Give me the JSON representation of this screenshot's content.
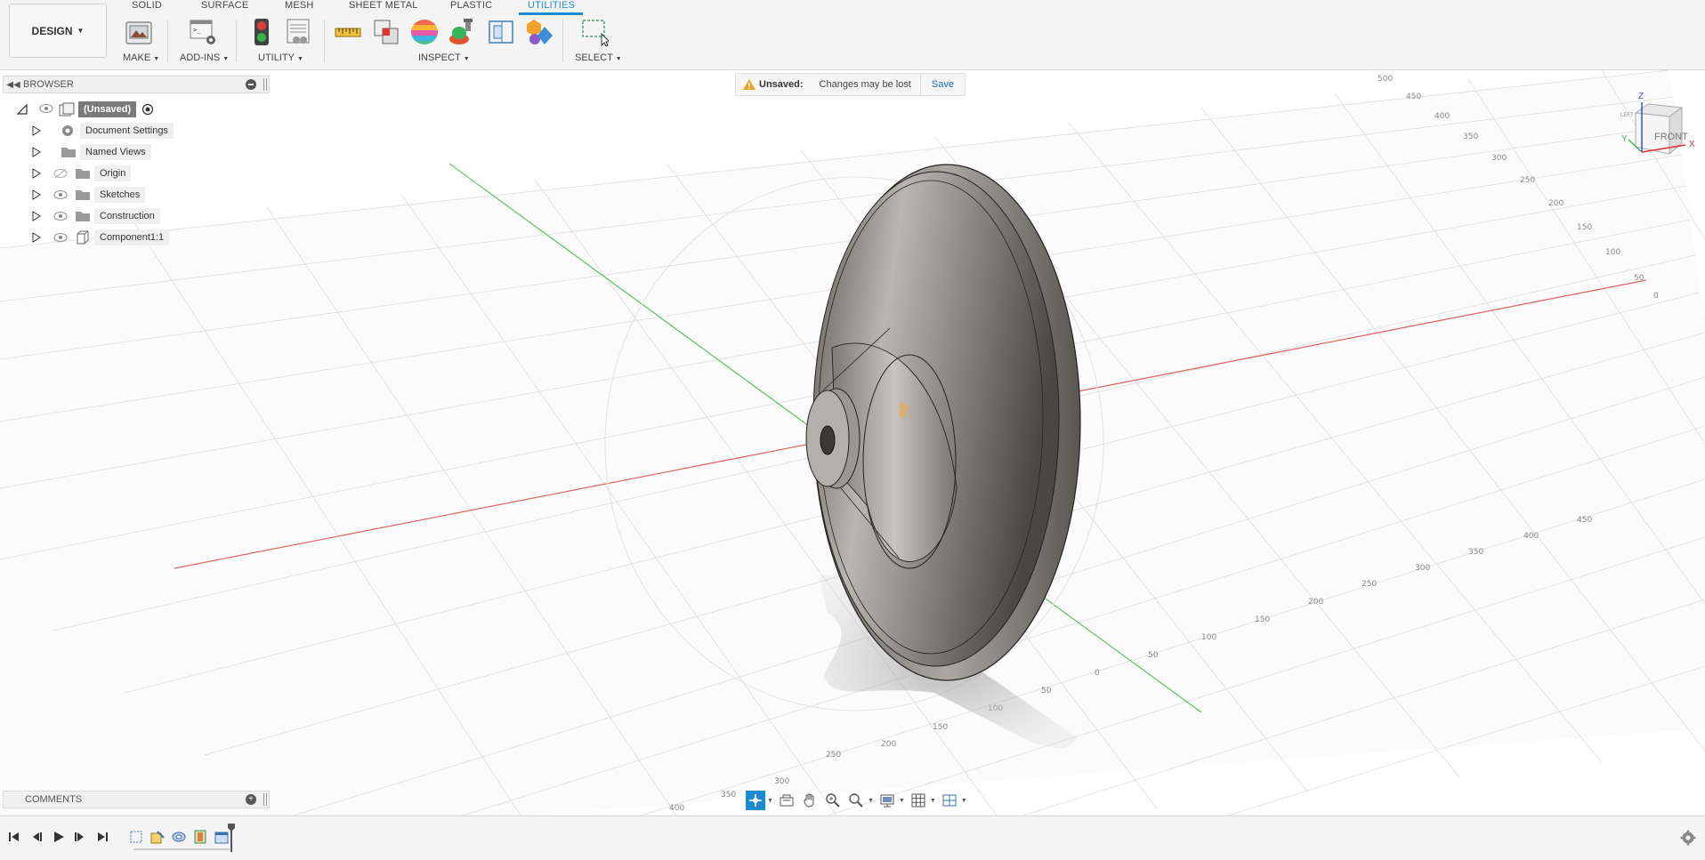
{
  "toolbar": {
    "workspace_label": "DESIGN",
    "tabs": [
      {
        "label": "SOLID",
        "active": false
      },
      {
        "label": "SURFACE",
        "active": false
      },
      {
        "label": "MESH",
        "active": false
      },
      {
        "label": "SHEET METAL",
        "active": false
      },
      {
        "label": "PLASTIC",
        "active": false
      },
      {
        "label": "UTILITIES",
        "active": true
      }
    ],
    "groups": {
      "make": "MAKE",
      "addins": "ADD-INS",
      "utility": "UTILITY",
      "inspect": "INSPECT",
      "select": "SELECT"
    },
    "accent_color": "#1a8ad2"
  },
  "browser": {
    "title": "BROWSER",
    "root_label": "(Unsaved)",
    "items": [
      {
        "label": "Document Settings",
        "icon": "gear-icon"
      },
      {
        "label": "Named Views",
        "icon": "folder-icon"
      },
      {
        "label": "Origin",
        "icon": "folder-icon",
        "visibility": "hidden"
      },
      {
        "label": "Sketches",
        "icon": "folder-icon",
        "visibility": "visible"
      },
      {
        "label": "Construction",
        "icon": "folder-icon",
        "visibility": "visible"
      },
      {
        "label": "Component1:1",
        "icon": "component-icon",
        "visibility": "visible"
      }
    ]
  },
  "banner": {
    "title": "Unsaved:",
    "message": "Changes may be lost",
    "save_label": "Save"
  },
  "viewcube": {
    "face_label": "FRONT",
    "side_label": "LEFT",
    "axes": [
      "Z",
      "X",
      "Y"
    ]
  },
  "grid_ticks": {
    "right_edge": [
      "500",
      "450",
      "400",
      "350",
      "300",
      "250",
      "200",
      "150",
      "100",
      "50",
      "0"
    ],
    "bottom_edge": [
      "400",
      "350",
      "300",
      "250",
      "200",
      "150",
      "100",
      "50",
      "0",
      "50",
      "100",
      "150",
      "200",
      "250",
      "300",
      "350",
      "400",
      "450"
    ]
  },
  "comments": {
    "title": "COMMENTS"
  },
  "navbar": {
    "icons": [
      "orbit-icon",
      "look-at-icon",
      "pan-icon",
      "zoom-icon",
      "fit-icon",
      "display-settings-icon",
      "grid-settings-icon",
      "viewports-icon"
    ]
  },
  "timeline": {
    "controls": [
      "skip-start-icon",
      "step-back-icon",
      "play-icon",
      "step-forward-icon",
      "skip-end-icon"
    ],
    "features": [
      "sketch-feature-icon",
      "sketch-feature-icon",
      "revolve-feature-icon",
      "shell-feature-icon",
      "component-feature-icon"
    ]
  }
}
